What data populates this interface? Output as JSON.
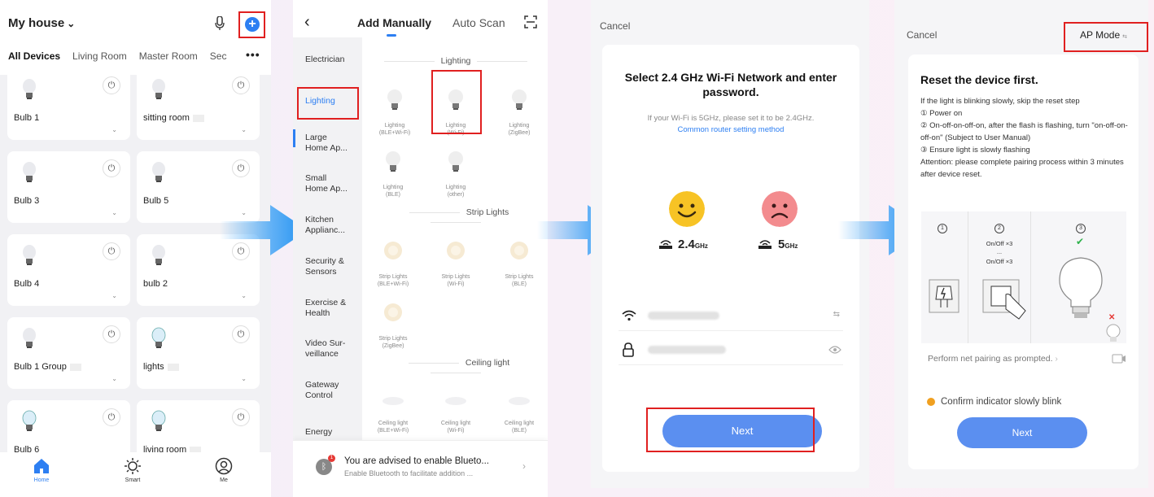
{
  "screen1": {
    "home_name": "My house",
    "tabs": [
      "All Devices",
      "Living Room",
      "Master Room",
      "Sec"
    ],
    "devices": [
      {
        "name": "Bulb 1"
      },
      {
        "name": "sitting room"
      },
      {
        "name": "Bulb 3"
      },
      {
        "name": "Bulb 5"
      },
      {
        "name": "Bulb 4"
      },
      {
        "name": "bulb 2"
      },
      {
        "name": "Bulb 1 Group"
      },
      {
        "name": "lights"
      },
      {
        "name": "Bulb 6"
      },
      {
        "name": "living room"
      }
    ],
    "nav": [
      "Home",
      "Smart",
      "Me"
    ]
  },
  "screen2": {
    "tab_manual": "Add Manually",
    "tab_auto": "Auto Scan",
    "categories": [
      "Electrician",
      "Lighting",
      "Large\nHome Ap...",
      "Small\nHome Ap...",
      "Kitchen\nApplianc...",
      "Security &\nSensors",
      "Exercise &\nHealth",
      "Video Sur-\nveillance",
      "Gateway\nControl",
      "Energy"
    ],
    "sections": {
      "lighting": "Lighting",
      "strip": "Strip Lights",
      "ceiling": "Ceiling light"
    },
    "lighting_items": [
      "Lighting\n(BLE+Wi-Fi)",
      "Lighting\n(Wi-Fi)",
      "Lighting\n(ZigBee)",
      "Lighting\n(BLE)",
      "Lighting\n(other)"
    ],
    "strip_items": [
      "Strip Lights\n(BLE+Wi-Fi)",
      "Strip Lights\n(Wi-Fi)",
      "Strip Lights\n(BLE)",
      "Strip Lights\n(ZigBee)"
    ],
    "ceiling_items": [
      "Ceiling light\n(BLE+Wi-Fi)",
      "Ceiling light\n(Wi-Fi)",
      "Ceiling light\n(BLE)"
    ],
    "banner_title": "You are advised to enable Blueto...",
    "banner_sub": "Enable Bluetooth to facilitate addition ...",
    "banner_badge": "1"
  },
  "screen3": {
    "cancel": "Cancel",
    "title": "Select 2.4 GHz Wi-Fi Network and enter password.",
    "hint": "If your Wi-Fi is 5GHz, please set it to be 2.4GHz.",
    "link": "Common router setting method",
    "band_good": "2.4",
    "band_good_unit": "GHz",
    "band_bad": "5",
    "band_bad_unit": "GHz",
    "next": "Next"
  },
  "screen4": {
    "cancel": "Cancel",
    "ap_mode": "AP Mode",
    "title": "Reset the device first.",
    "steps": [
      "If the light is blinking slowly, skip the reset step",
      "①  Power on",
      "②  On-off-on-off-on, after the flash is flashing, turn \"on-off-on-off-on\" (Subject to User Manual)",
      "③ Ensure  light is slowly flashing",
      "Attention: please complete pairing process within 3 minutes after device reset."
    ],
    "onoff_1": "On/Off ×3",
    "onoff_dots": "...",
    "onoff_2": "On/Off ×3",
    "prompt": "Perform net pairing as prompted.",
    "confirm": "Confirm indicator slowly blink",
    "next": "Next"
  },
  "colors": {
    "accent": "#2d7ff2",
    "button": "#5b8ff0",
    "highlight_box": "#e02020",
    "arrow": "#3aa0f5"
  }
}
